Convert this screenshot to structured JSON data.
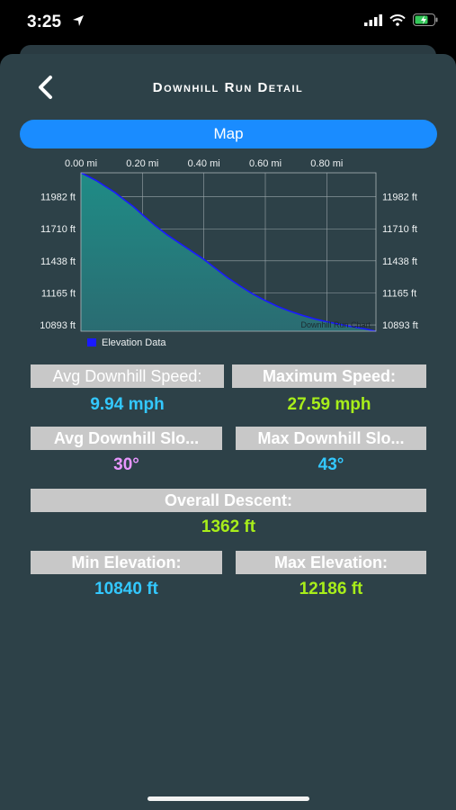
{
  "status_bar": {
    "time": "3:25",
    "icons": [
      "location-arrow-icon",
      "signal-icon",
      "wifi-icon",
      "battery-charging-icon"
    ]
  },
  "header": {
    "title": "Downhill Run Detail",
    "back_icon": "chevron-left-icon"
  },
  "map_button": {
    "label": "Map"
  },
  "chart_data": {
    "type": "area",
    "title": "Downhill Run Chart",
    "xlabel": "",
    "ylabel": "",
    "x_ticks": [
      "0.00 mi",
      "0.20 mi",
      "0.40 mi",
      "0.60 mi",
      "0.80 mi"
    ],
    "y_ticks": [
      "11982 ft",
      "11710 ft",
      "11438 ft",
      "11165 ft",
      "10893 ft"
    ],
    "xlim": [
      0,
      0.96
    ],
    "ylim": [
      10840,
      12186
    ],
    "grid": true,
    "legend": "bottom-left",
    "series": [
      {
        "name": "Elevation Data",
        "color": "#1a1aff",
        "x": [
          0.0,
          0.02,
          0.05,
          0.08,
          0.11,
          0.14,
          0.17,
          0.2,
          0.24,
          0.28,
          0.32,
          0.36,
          0.4,
          0.44,
          0.48,
          0.52,
          0.56,
          0.6,
          0.64,
          0.68,
          0.72,
          0.76,
          0.8,
          0.84,
          0.88,
          0.92,
          0.96
        ],
        "y": [
          12186,
          12160,
          12120,
          12070,
          12020,
          11960,
          11900,
          11830,
          11740,
          11660,
          11590,
          11520,
          11450,
          11370,
          11290,
          11220,
          11155,
          11100,
          11050,
          11010,
          10975,
          10945,
          10920,
          10900,
          10880,
          10862,
          10840
        ]
      }
    ]
  },
  "stats": {
    "avg_speed": {
      "label": "Avg Downhill Speed:",
      "value": "9.94 mph"
    },
    "max_speed": {
      "label": "Maximum Speed:",
      "value": "27.59 mph"
    },
    "avg_slope": {
      "label": "Avg Downhill Slo...",
      "value": "30°"
    },
    "max_slope": {
      "label": "Max Downhill Slo...",
      "value": "43°"
    },
    "descent": {
      "label": "Overall Descent:",
      "value": "1362 ft"
    },
    "min_elev": {
      "label": "Min Elevation:",
      "value": "10840 ft"
    },
    "max_elev": {
      "label": "Max Elevation:",
      "value": "12186 ft"
    }
  },
  "colors": {
    "blue_value": "#33c8ff",
    "green_value": "#a8ee1a",
    "pink_value": "#e896ff",
    "map_button": "#1a8cff",
    "background": "#2d4148"
  }
}
